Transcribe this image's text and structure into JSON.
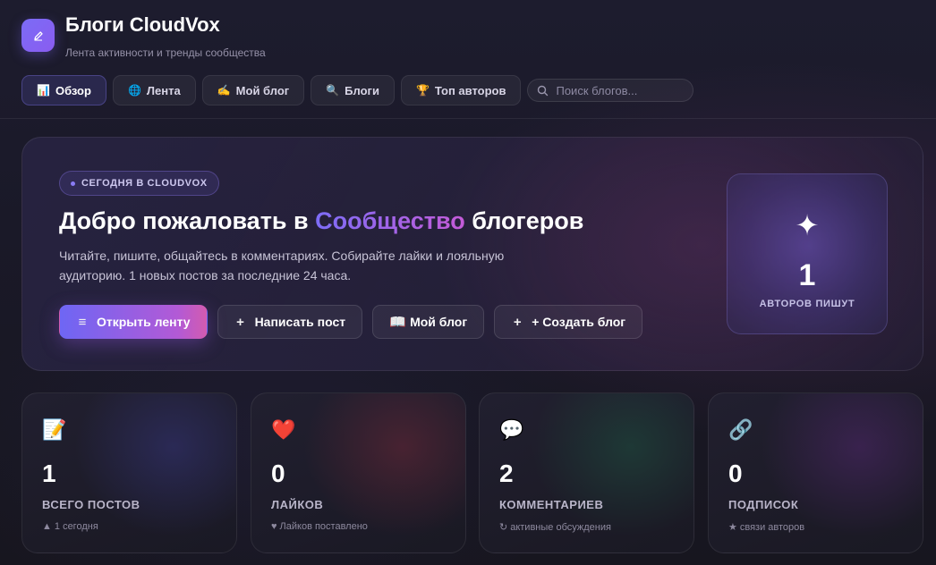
{
  "app": {
    "title": "Блоги CloudVox",
    "subtitle": "Лента активности и тренды сообщества",
    "logo_icon": "pencil-icon",
    "accent": "#7b6cf6"
  },
  "nav": {
    "items": [
      {
        "emoji": "📊",
        "label": "Обзор",
        "icon": "chart-icon",
        "active": true
      },
      {
        "emoji": "🌐",
        "label": "Лента",
        "icon": "globe-icon"
      },
      {
        "emoji": "✍️",
        "label": "Мой блог",
        "icon": "writing-hand-icon"
      },
      {
        "emoji": "🔍",
        "label": "Блоги",
        "icon": "search-icon"
      },
      {
        "emoji": "🏆",
        "label": "Топ авторов",
        "icon": "trophy-icon"
      }
    ],
    "search_placeholder": "Поиск блогов..."
  },
  "hero": {
    "badge": "СЕГОДНЯ В CLOUDVOX",
    "title_before": "Добро пожаловать в ",
    "title_accent": "Сообщество",
    "title_after": " блогеров",
    "text": "Читайте, пишите, общайтесь в комментариях. Собирайте лайки и лояльную аудиторию. 1 новых постов за последние 24 часа.",
    "actions": [
      {
        "icon": "≡",
        "label": "Открыть ленту",
        "primary": true
      },
      {
        "icon": "+",
        "label": "Написать пост"
      },
      {
        "icon": "📖",
        "label": "Мой блог"
      },
      {
        "icon": "+",
        "label": "+ Создать блог"
      }
    ],
    "card": {
      "icon": "✦",
      "value": "1",
      "label": "АВТОРОВ ПИШУТ"
    }
  },
  "stats": [
    {
      "icon": "📝",
      "value": "1",
      "label": "ВСЕГО ПОСТОВ",
      "sub_mark": "▲",
      "sub": "1 сегодня",
      "glow": "#3a3a8a"
    },
    {
      "icon": "❤️",
      "value": "0",
      "label": "ЛАЙКОВ",
      "sub_mark": "♥",
      "sub": "Лайков поставлено",
      "glow": "#7a2a3a"
    },
    {
      "icon": "💬",
      "value": "2",
      "label": "КОММЕНТАРИЕВ",
      "sub_mark": "↻",
      "sub": "активные обсуждения",
      "glow": "#1f5a44"
    },
    {
      "icon": "🔗",
      "value": "0",
      "label": "ПОДПИСОК",
      "sub_mark": "★",
      "sub": "связи авторов",
      "glow": "#5a2a7a"
    }
  ]
}
